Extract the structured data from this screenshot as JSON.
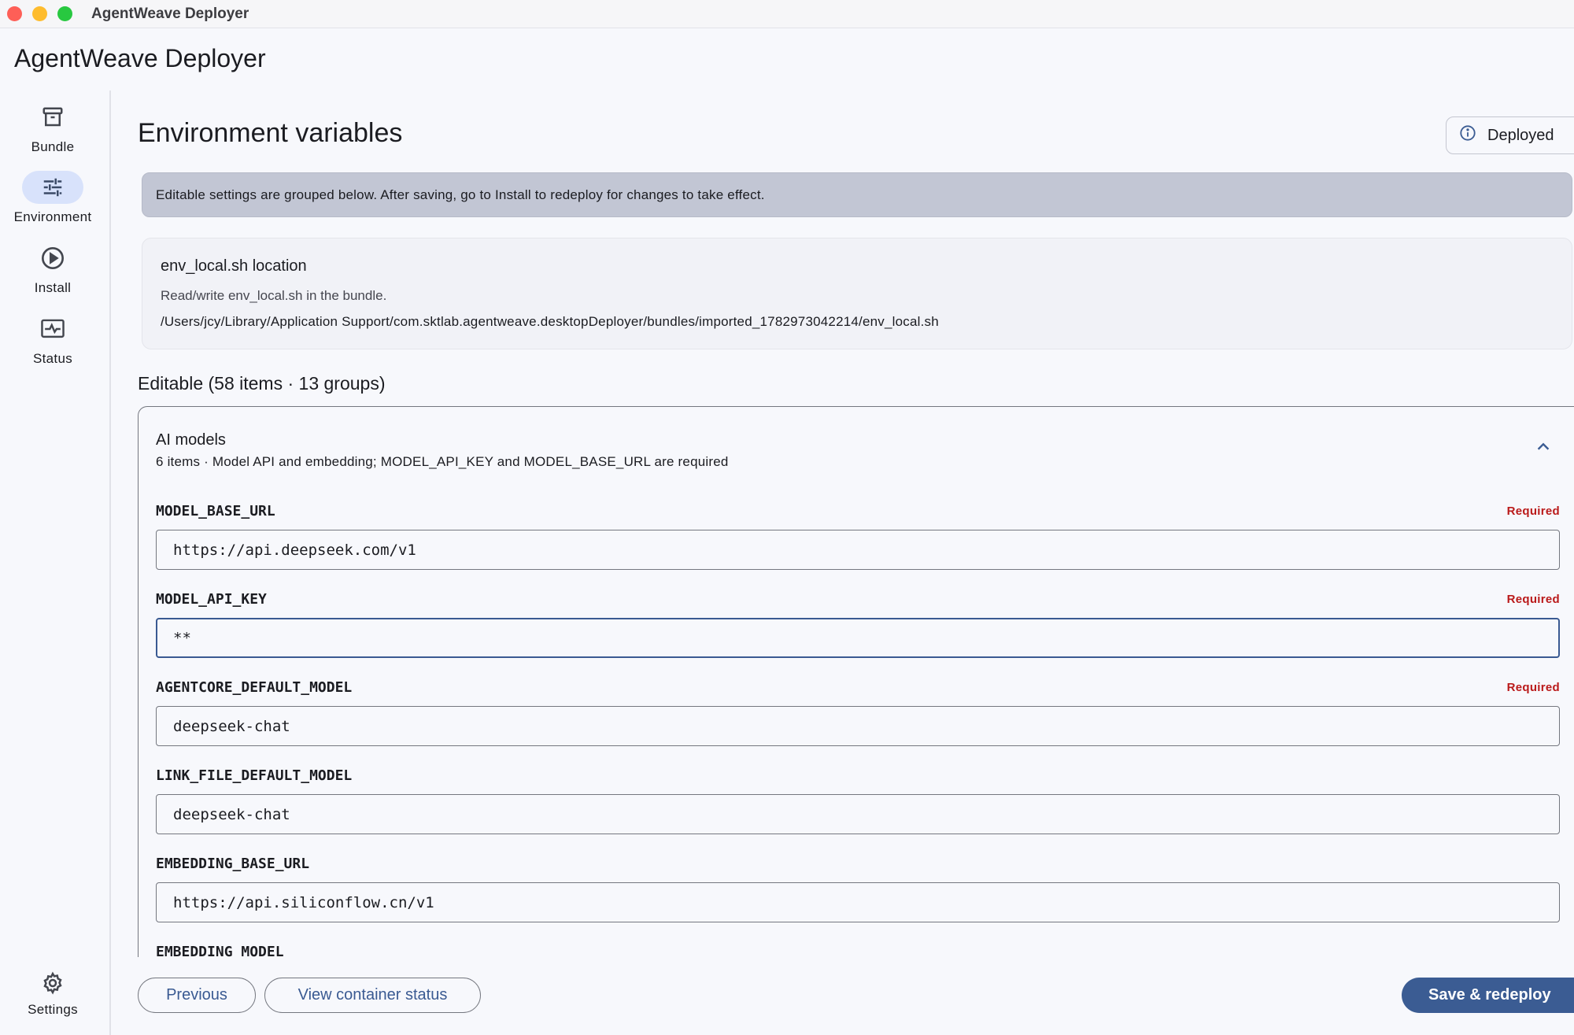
{
  "window": {
    "title": "AgentWeave Deployer"
  },
  "app": {
    "title": "AgentWeave Deployer"
  },
  "nav": {
    "items": [
      {
        "label": "Bundle",
        "icon": "archive-icon"
      },
      {
        "label": "Environment",
        "icon": "tune-sliders-icon",
        "active": true
      },
      {
        "label": "Install",
        "icon": "play-circle-icon"
      },
      {
        "label": "Status",
        "icon": "monitor-heart-icon"
      }
    ],
    "settings": {
      "label": "Settings",
      "icon": "gear-icon"
    }
  },
  "page": {
    "title": "Environment variables",
    "status_chip": {
      "label": "Deployed",
      "icon": "info-icon"
    },
    "banner": "Editable settings are grouped below. After saving, go to Install to redeploy for changes to take effect."
  },
  "location": {
    "title": "env_local.sh location",
    "description": "Read/write env_local.sh in the bundle.",
    "path": "/Users/jcy/Library/Application Support/com.sktlab.agentweave.desktopDeployer/bundles/imported_1782973042214/env_local.sh"
  },
  "editable": {
    "heading": "Editable (58 items · 13 groups)",
    "group": {
      "name": "AI models",
      "description": "6 items · Model API and embedding; MODEL_API_KEY and MODEL_BASE_URL are required",
      "expanded": true,
      "fields": [
        {
          "key": "MODEL_BASE_URL",
          "required_label": "Required",
          "value": "https://api.deepseek.com/v1"
        },
        {
          "key": "MODEL_API_KEY",
          "required_label": "Required",
          "value": "**",
          "focused": true
        },
        {
          "key": "AGENTCORE_DEFAULT_MODEL",
          "required_label": "Required",
          "value": "deepseek-chat"
        },
        {
          "key": "LINK_FILE_DEFAULT_MODEL",
          "required_label": "",
          "value": "deepseek-chat"
        },
        {
          "key": "EMBEDDING_BASE_URL",
          "required_label": "",
          "value": "https://api.siliconflow.cn/v1"
        },
        {
          "key": "EMBEDDING_MODEL",
          "required_label": "",
          "value": ""
        }
      ]
    }
  },
  "actions": {
    "previous": "Previous",
    "view_status": "View container status",
    "save": "Save & redeploy"
  },
  "colors": {
    "primary": "#3b5c93",
    "required": "#ba1a1a",
    "active_nav": "#d8e2fb",
    "banner": "#c2c6d4"
  }
}
